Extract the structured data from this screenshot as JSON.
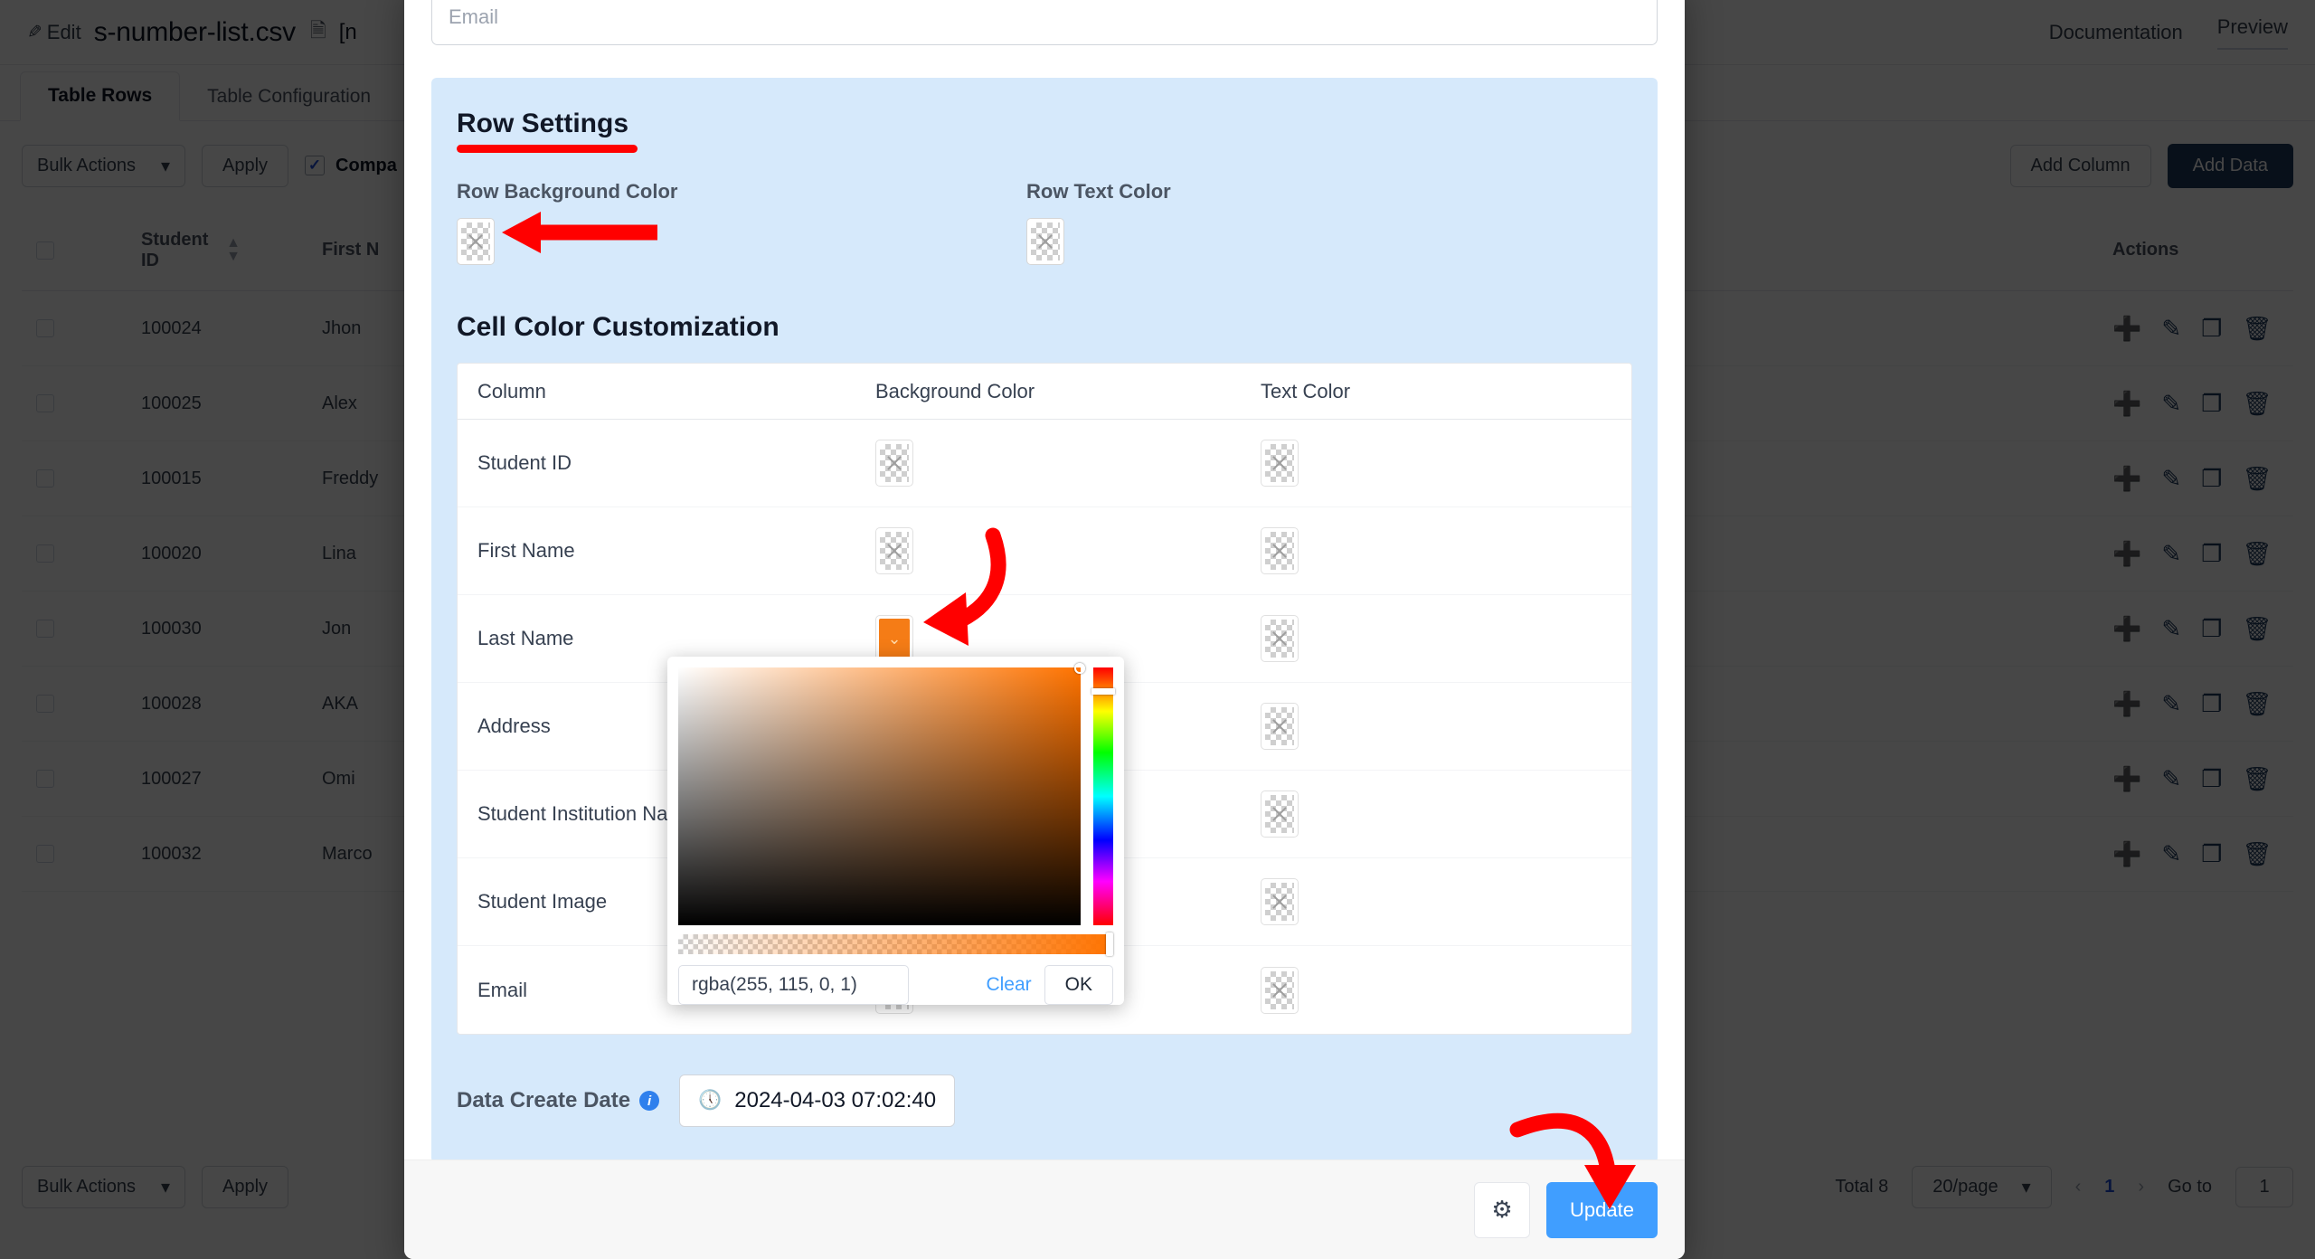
{
  "background": {
    "header": {
      "edit_label": "Edit",
      "edit_icon": "pencil-icon",
      "file_name": "s-number-list.csv",
      "doc_icon": "document-icon",
      "shortcode": "[n",
      "documentation_label": "Documentation",
      "preview_label": "Preview"
    },
    "tabs": [
      {
        "label": "Table Rows",
        "active": true
      },
      {
        "label": "Table Configuration",
        "active": false
      }
    ],
    "toolbar": {
      "bulk_actions_label": "Bulk Actions",
      "chevron_icon": "chevron-down-icon",
      "apply_label": "Apply",
      "compact_label": "Compa",
      "check_icon": "check-icon",
      "add_column_label": "Add Column",
      "add_data_label": "Add Data"
    },
    "table": {
      "columns": [
        "Student ID",
        "First N",
        "Actions"
      ],
      "sort_icon": "sort-icon",
      "row_action_icons": [
        "plus-icon",
        "pencil-icon",
        "duplicate-icon",
        "trash-icon"
      ],
      "rows": [
        {
          "student_id": "100024",
          "first_name": "Jhon"
        },
        {
          "student_id": "100025",
          "first_name": "Alex"
        },
        {
          "student_id": "100015",
          "first_name": "Freddy"
        },
        {
          "student_id": "100020",
          "first_name": "Lina"
        },
        {
          "student_id": "100030",
          "first_name": "Jon"
        },
        {
          "student_id": "100028",
          "first_name": "AKA"
        },
        {
          "student_id": "100027",
          "first_name": "Omi"
        },
        {
          "student_id": "100032",
          "first_name": "Marco"
        }
      ]
    },
    "footer": {
      "bulk_actions_label": "Bulk Actions",
      "apply_label": "Apply",
      "total_label": "Total 8",
      "page_size": "20/page",
      "prev_icon": "chevron-left-icon",
      "current_page": "1",
      "next_icon": "chevron-right-icon",
      "goto_label": "Go to",
      "goto_value": "1"
    }
  },
  "modal": {
    "email_field": {
      "value": "",
      "placeholder": "Email"
    },
    "row_settings": {
      "title": "Row Settings",
      "underline_color": "#ff0000",
      "background_color_label": "Row Background Color",
      "text_color_label": "Row Text Color",
      "background_swatch": "transparent",
      "text_swatch": "transparent"
    },
    "cell_color": {
      "title": "Cell Color Customization",
      "headers": [
        "Column",
        "Background Color",
        "Text Color"
      ],
      "rows": [
        {
          "column": "Student ID",
          "background": "transparent",
          "text": "transparent"
        },
        {
          "column": "First Name",
          "background": "transparent",
          "text": "transparent"
        },
        {
          "column": "Last Name",
          "background": "#f57c16",
          "text": "transparent"
        },
        {
          "column": "Address",
          "background": "transparent",
          "text": "transparent"
        },
        {
          "column": "Student Institution Nam",
          "background": "transparent",
          "text": "transparent"
        },
        {
          "column": "Student Image",
          "background": "transparent",
          "text": "transparent"
        },
        {
          "column": "Email",
          "background": "transparent",
          "text": "transparent"
        }
      ]
    },
    "create_date": {
      "label": "Data Create Date",
      "info_icon": "info-icon",
      "clock_icon": "clock-icon",
      "value": "2024-04-03 07:02:40"
    },
    "footer": {
      "gear_icon": "gear-icon",
      "update_label": "Update",
      "update_color": "#409eff"
    }
  },
  "color_picker": {
    "selected_color": "rgba(255, 115, 0, 1)",
    "value_input": "rgba(255, 115, 0, 1)",
    "clear_label": "Clear",
    "ok_label": "OK",
    "hue_label": "hue-slider",
    "alpha_label": "alpha-slider"
  }
}
